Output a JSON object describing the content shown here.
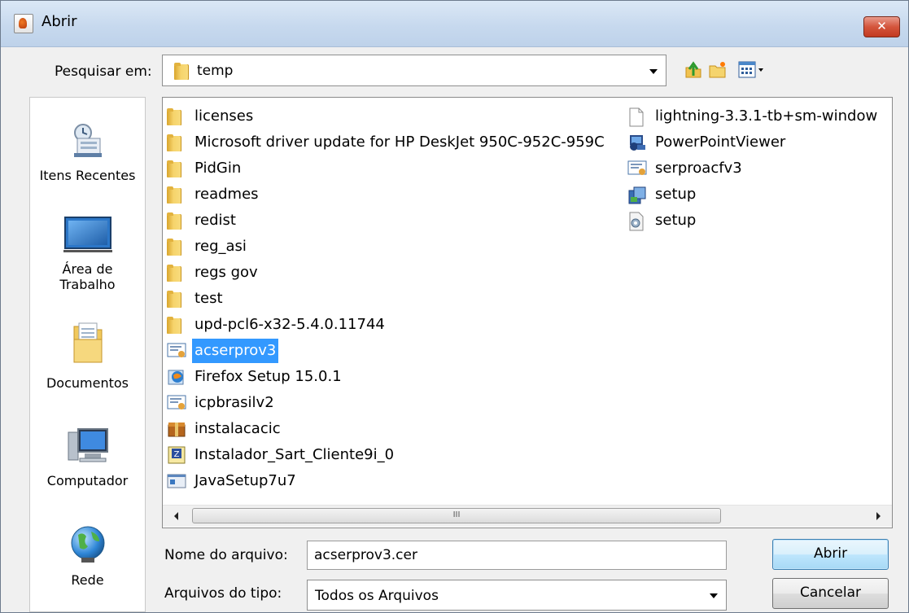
{
  "window": {
    "title": "Abrir",
    "close_glyph": "✕"
  },
  "lookin": {
    "label": "Pesquisar em:",
    "value": "temp"
  },
  "toolbar": {
    "icons": [
      "up-folder-icon",
      "new-folder-icon",
      "view-menu-icon"
    ]
  },
  "places": [
    {
      "label_lines": [
        "Itens Recentes"
      ],
      "icon": "recent-items-icon"
    },
    {
      "label_lines": [
        "Área de",
        "Trabalho"
      ],
      "icon": "desktop-icon"
    },
    {
      "label_lines": [
        "Documentos"
      ],
      "icon": "documents-icon"
    },
    {
      "label_lines": [
        "Computador"
      ],
      "icon": "computer-icon"
    },
    {
      "label_lines": [
        "Rede"
      ],
      "icon": "network-icon"
    }
  ],
  "files": {
    "column1": [
      {
        "name": "licenses",
        "type": "folder"
      },
      {
        "name": "Microsoft driver update for HP DeskJet 950C-952C-959C",
        "type": "folder"
      },
      {
        "name": "PidGin",
        "type": "folder"
      },
      {
        "name": "readmes",
        "type": "folder"
      },
      {
        "name": "redist",
        "type": "folder"
      },
      {
        "name": "reg_asi",
        "type": "folder"
      },
      {
        "name": "regs gov",
        "type": "folder"
      },
      {
        "name": "test",
        "type": "folder"
      },
      {
        "name": "upd-pcl6-x32-5.4.0.11744",
        "type": "folder"
      },
      {
        "name": "acserprov3",
        "type": "certificate",
        "selected": true
      },
      {
        "name": "Firefox Setup 15.0.1",
        "type": "installer"
      },
      {
        "name": "icpbrasilv2",
        "type": "certificate"
      },
      {
        "name": "instalacacic",
        "type": "package"
      },
      {
        "name": "Instalador_Sart_Cliente9i_0",
        "type": "zip"
      },
      {
        "name": "JavaSetup7u7",
        "type": "exe"
      }
    ],
    "column2": [
      {
        "name": "lightning-3.3.1-tb+sm-window",
        "type": "document"
      },
      {
        "name": "PowerPointViewer",
        "type": "installer"
      },
      {
        "name": "serproacfv3",
        "type": "certificate"
      },
      {
        "name": "setup",
        "type": "setup-exe"
      },
      {
        "name": "setup",
        "type": "config"
      }
    ]
  },
  "scrollbar": {
    "grip": "III"
  },
  "filename": {
    "label": "Nome do arquivo:",
    "value": "acserprov3.cer"
  },
  "filetype": {
    "label": "Arquivos do tipo:",
    "value": "Todos os Arquivos"
  },
  "buttons": {
    "open": "Abrir",
    "cancel": "Cancelar"
  }
}
